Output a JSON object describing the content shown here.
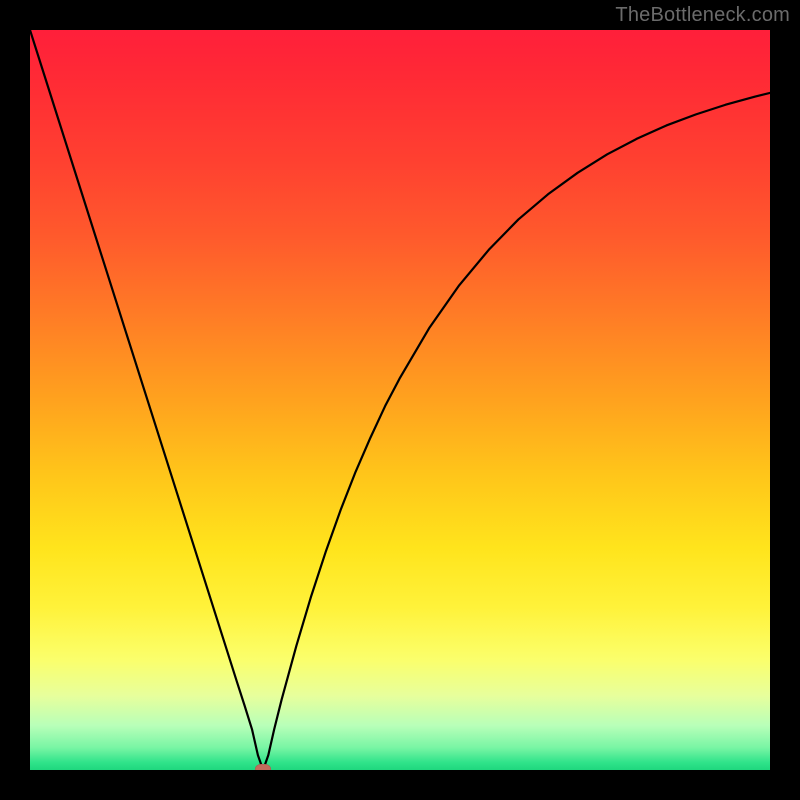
{
  "watermark": "TheBottleneck.com",
  "chart_data": {
    "type": "line",
    "title": "",
    "xlabel": "",
    "ylabel": "",
    "xlim": [
      0,
      100
    ],
    "ylim": [
      0,
      100
    ],
    "grid": false,
    "legend": false,
    "background_gradient": {
      "top": "#ff1f3a",
      "mid": "#ffe41c",
      "bottom": "#1fd77e"
    },
    "minimum_marker": {
      "x": 31.5,
      "y": 0,
      "color": "#c36b5c"
    },
    "series": [
      {
        "name": "bottleneck-curve",
        "color": "#000000",
        "x": [
          0,
          2,
          4,
          6,
          8,
          10,
          12,
          14,
          16,
          18,
          20,
          22,
          24,
          26,
          28,
          29,
          30,
          30.8,
          31.5,
          32.2,
          33,
          34,
          36,
          38,
          40,
          42,
          44,
          46,
          48,
          50,
          54,
          58,
          62,
          66,
          70,
          74,
          78,
          82,
          86,
          90,
          94,
          98,
          100
        ],
        "y": [
          100,
          93.7,
          87.4,
          81.1,
          74.8,
          68.5,
          62.2,
          55.9,
          49.6,
          43.3,
          37.0,
          30.7,
          24.4,
          18.1,
          11.8,
          8.7,
          5.5,
          2.0,
          0.0,
          2.0,
          5.5,
          9.5,
          16.8,
          23.5,
          29.6,
          35.2,
          40.3,
          44.9,
          49.2,
          53.0,
          59.8,
          65.5,
          70.3,
          74.4,
          77.8,
          80.7,
          83.2,
          85.3,
          87.1,
          88.6,
          89.9,
          91.0,
          91.5
        ]
      }
    ]
  }
}
